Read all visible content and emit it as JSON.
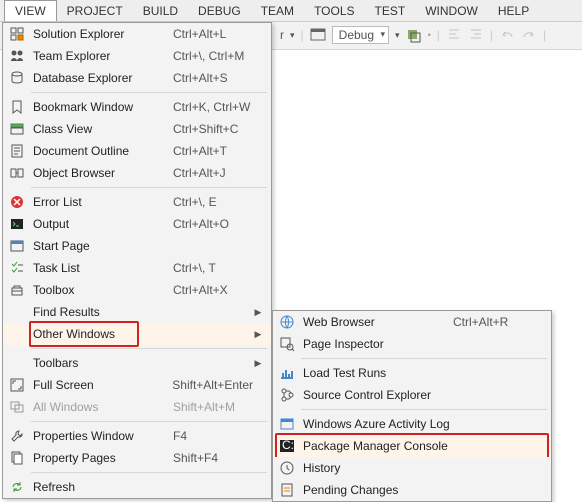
{
  "menubar": [
    "VIEW",
    "PROJECT",
    "BUILD",
    "DEBUG",
    "TEAM",
    "TOOLS",
    "TEST",
    "WINDOW",
    "HELP"
  ],
  "toolbar": {
    "combolabel": "Debug",
    "after_r": "r"
  },
  "menu": [
    {
      "icon": "solution-explorer",
      "label": "Solution Explorer",
      "short": "Ctrl+Alt+L"
    },
    {
      "icon": "team-explorer",
      "label": "Team Explorer",
      "short": "Ctrl+\\, Ctrl+M"
    },
    {
      "icon": "database-explorer",
      "label": "Database Explorer",
      "short": "Ctrl+Alt+S"
    },
    {
      "sep": true
    },
    {
      "icon": "bookmark",
      "label": "Bookmark Window",
      "short": "Ctrl+K, Ctrl+W"
    },
    {
      "icon": "class-view",
      "label": "Class View",
      "short": "Ctrl+Shift+C"
    },
    {
      "icon": "doc-outline",
      "label": "Document Outline",
      "short": "Ctrl+Alt+T"
    },
    {
      "icon": "object-browser",
      "label": "Object Browser",
      "short": "Ctrl+Alt+J"
    },
    {
      "sep": true
    },
    {
      "icon": "error-list",
      "label": "Error List",
      "short": "Ctrl+\\, E"
    },
    {
      "icon": "output",
      "label": "Output",
      "short": "Ctrl+Alt+O"
    },
    {
      "icon": "start-page",
      "label": "Start Page",
      "short": ""
    },
    {
      "icon": "task-list",
      "label": "Task List",
      "short": "Ctrl+\\, T"
    },
    {
      "icon": "toolbox",
      "label": "Toolbox",
      "short": "Ctrl+Alt+X"
    },
    {
      "icon": "",
      "label": "Find Results",
      "short": "",
      "sub": true
    },
    {
      "icon": "",
      "label": "Other Windows",
      "short": "",
      "sub": true,
      "hover": true,
      "red": true
    },
    {
      "sep": true
    },
    {
      "icon": "",
      "label": "Toolbars",
      "short": "",
      "sub": true
    },
    {
      "icon": "fullscreen",
      "label": "Full Screen",
      "short": "Shift+Alt+Enter"
    },
    {
      "icon": "all-windows",
      "label": "All Windows",
      "short": "Shift+Alt+M",
      "disabled": true
    },
    {
      "sep": true
    },
    {
      "icon": "wrench",
      "label": "Properties Window",
      "short": "F4"
    },
    {
      "icon": "pages",
      "label": "Property Pages",
      "short": "Shift+F4"
    },
    {
      "sep": true
    },
    {
      "icon": "refresh",
      "label": "Refresh",
      "short": ""
    }
  ],
  "submenu": [
    {
      "icon": "web",
      "label": "Web Browser",
      "short": "Ctrl+Alt+R"
    },
    {
      "icon": "inspector",
      "label": "Page Inspector",
      "short": ""
    },
    {
      "sep": true
    },
    {
      "icon": "loadtest",
      "label": "Load Test Runs",
      "short": ""
    },
    {
      "icon": "source-control",
      "label": "Source Control Explorer",
      "short": ""
    },
    {
      "sep": true
    },
    {
      "icon": "azure",
      "label": "Windows Azure Activity Log",
      "short": ""
    },
    {
      "icon": "pmconsole",
      "label": "Package Manager Console",
      "short": "",
      "hover": true,
      "red": true
    },
    {
      "icon": "history",
      "label": "History",
      "short": ""
    },
    {
      "icon": "pending",
      "label": "Pending Changes",
      "short": ""
    }
  ]
}
